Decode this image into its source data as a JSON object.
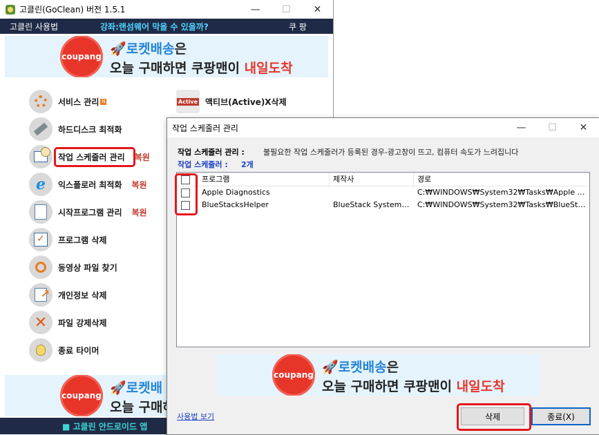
{
  "main": {
    "title": "고클린(GoClean) 버전 1.5.1",
    "minimize": "—",
    "maximize": "☐",
    "close": "✕",
    "menu": {
      "usage": "고클린 사용법",
      "promo": "강좌:랜섬웨어 막을 수 있을까?",
      "coupon": "쿠 팡"
    },
    "banner": {
      "badge": "coupang",
      "line1_blue": "로켓배송",
      "line1_rest": "은",
      "line2_start": "오늘 구매하면 쿠팡맨이 ",
      "line2_red": "내일도착"
    },
    "features": [
      {
        "label": "서비스 관리",
        "icon": "gear-icon",
        "badge": "N"
      },
      {
        "label": "하드디스크 최적화",
        "icon": "wrench-disk-icon"
      },
      {
        "label": "작업 스케줄러 관리",
        "icon": "scheduler-clock-icon",
        "restore": "복원"
      },
      {
        "label": "익스플로러 최적화",
        "icon": "ie-icon",
        "restore": "복원"
      },
      {
        "label": "시작프로그램 관리",
        "icon": "document-icon",
        "restore": "복원"
      },
      {
        "label": "프로그램 삭제",
        "icon": "checklist-icon"
      },
      {
        "label": "동영상 파일 찾기",
        "icon": "magnifier-icon"
      },
      {
        "label": "개인정보 삭제",
        "icon": "privacy-arrow-icon"
      },
      {
        "label": "파일 강제삭제",
        "icon": "delete-x-icon"
      },
      {
        "label": "종료 타이머",
        "icon": "sleep-bulb-icon"
      }
    ],
    "activex_label": "액티브(Active)X삭제",
    "activex_icon_text": "Active",
    "bottom_banner": {
      "badge": "coupang",
      "line1_blue": "로켓배",
      "line2_start": "오늘 구매하"
    },
    "footer": "■ 고클린 안드로이드 앱"
  },
  "dialog": {
    "title": "작업 스케줄러 관리",
    "info_label": "작업 스케줄러 관리 :",
    "info_desc": "불필요한 작업 스케줄러가 등록된 경우-광고창이 뜨고, 컴퓨터 속도가 느려집니다",
    "count_label": "작업 스케줄러 :",
    "count_value": "2개",
    "columns": [
      "프로그램",
      "제작사",
      "경로"
    ],
    "rows": [
      {
        "program": "Apple Diagnostics",
        "vendor": "",
        "path": "C:₩WINDOWS₩System32₩Tasks₩Apple Dia..."
      },
      {
        "program": "BlueStacksHelper",
        "vendor": "BlueStack Systems, ...",
        "path": "C:₩WINDOWS₩System32₩Tasks₩BlueStack..."
      }
    ],
    "banner": {
      "badge": "coupang",
      "line1_blue": "로켓배송",
      "line1_rest": "은",
      "line2_start": "오늘 구매하면 쿠팡맨이 ",
      "line2_red": "내일도착"
    },
    "help_link": "사용법 보기",
    "delete_button": "삭제",
    "close_button": "종료(X)"
  }
}
